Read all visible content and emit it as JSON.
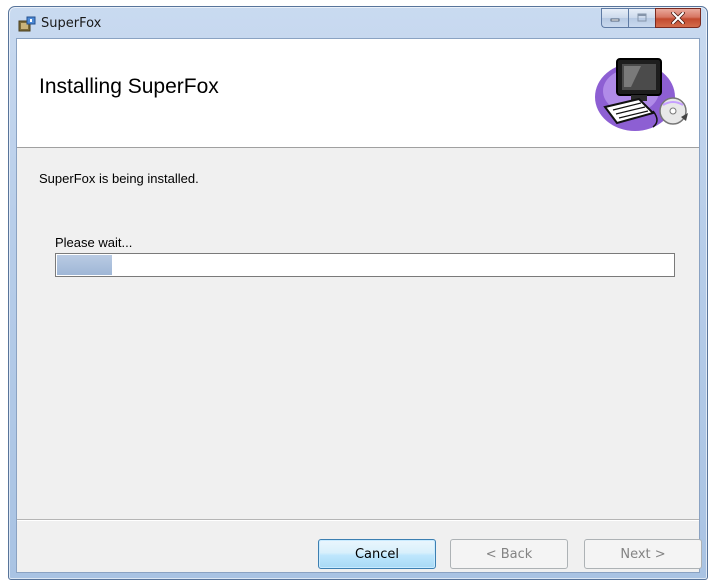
{
  "window": {
    "title": "SuperFox",
    "controls": {
      "minimize": "minimize",
      "maximize": "maximize",
      "close": "close"
    }
  },
  "banner": {
    "title": "Installing SuperFox",
    "graphic": "computer-install-icon"
  },
  "body": {
    "status": "SuperFox is being installed.",
    "wait_label": "Please wait...",
    "progress_fraction": 0.09
  },
  "buttons": {
    "cancel": "Cancel",
    "back": "< Back",
    "next": "Next >"
  },
  "colors": {
    "progress_fill": "#9fb7d6",
    "dialog_bg": "#f0f0f0",
    "close_button": "#c24a2f"
  }
}
